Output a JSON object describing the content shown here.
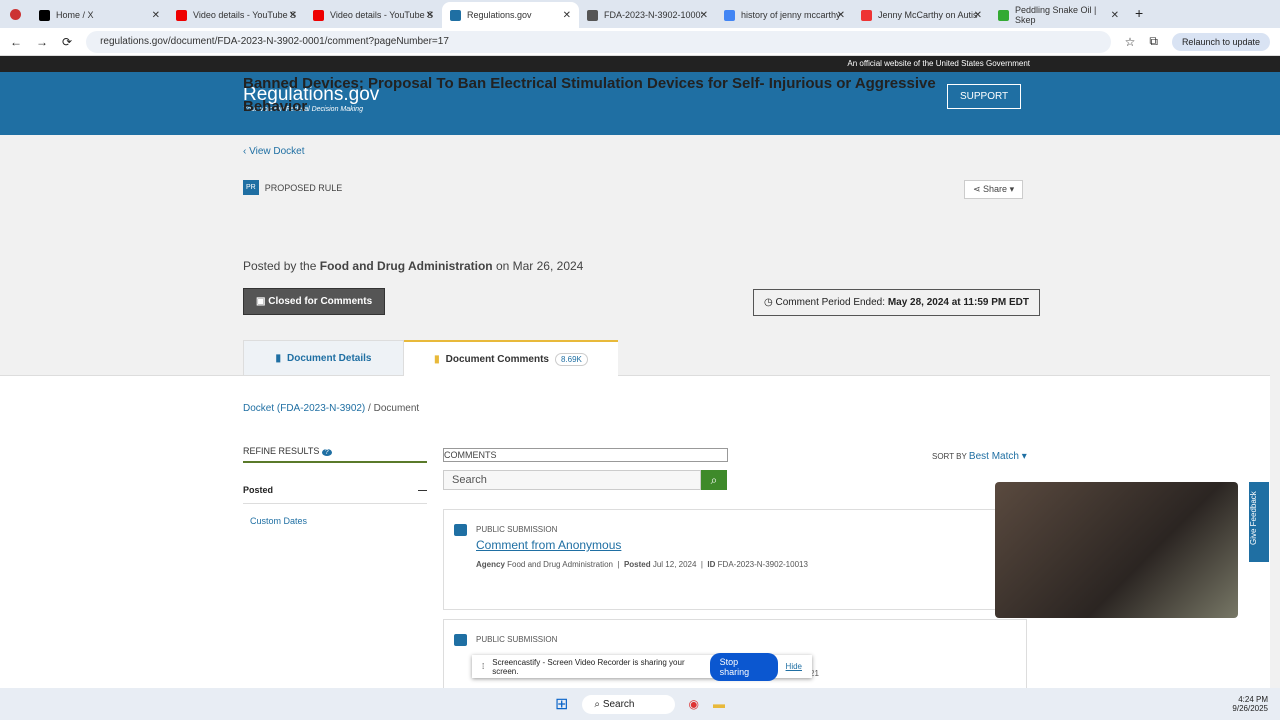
{
  "browser": {
    "tabs": [
      {
        "title": "Home / X",
        "color": "#000"
      },
      {
        "title": "Video details - YouTube S",
        "color": "#e00"
      },
      {
        "title": "Video details - YouTube S",
        "color": "#e00"
      },
      {
        "title": "Regulations.gov",
        "color": "#1f6fa3"
      },
      {
        "title": "FDA-2023-N-3902-1000:",
        "color": "#555"
      },
      {
        "title": "history of jenny mccarthy",
        "color": "#4285f4"
      },
      {
        "title": "Jenny McCarthy on Autis",
        "color": "#e33"
      },
      {
        "title": "Peddling Snake Oil | Skep",
        "color": "#3a3"
      }
    ],
    "url": "regulations.gov/document/FDA-2023-N-3902-0001/comment?pageNumber=17",
    "relaunch": "Relaunch to update"
  },
  "site": {
    "gov_banner": "An official website of the United States Government",
    "logo": "Regulations.gov",
    "tagline": "Your Voice in Federal Decision Making",
    "support": "SUPPORT"
  },
  "doc": {
    "back": "View Docket",
    "type_badge": "PR",
    "type": "PROPOSED RULE",
    "share": "Share",
    "title": "Banned Devices; Proposal To Ban Electrical Stimulation Devices for Self- Injurious or Aggressive Behavior",
    "posted_prefix": "Posted by the",
    "agency": "Food and Drug Administration",
    "posted_on": "on Mar 26, 2024",
    "closed": "Closed for Comments",
    "period_label": "Comment Period Ended:",
    "period_value": "May 28, 2024 at 11:59 PM EDT"
  },
  "tabs": {
    "details": "Document Details",
    "comments": "Document Comments",
    "count": "8.69K"
  },
  "breadcrumb": {
    "docket": "Docket (FDA-2023-N-3902)",
    "current": "Document"
  },
  "refine": {
    "title": "REFINE RESULTS",
    "posted": "Posted",
    "custom": "Custom Dates"
  },
  "search": {
    "label": "COMMENTS",
    "placeholder": "Search",
    "sort_label": "SORT BY",
    "sort_value": "Best Match"
  },
  "results": [
    {
      "kind": "PUBLIC SUBMISSION",
      "title": "Comment from Anonymous",
      "agency_label": "Agency",
      "agency": "Food and Drug Administration",
      "posted_label": "Posted",
      "posted": "Jul 12, 2024",
      "id_label": "ID",
      "id": "FDA-2023-N-3902-10013"
    },
    {
      "kind": "PUBLIC SUBMISSION",
      "tail": "21"
    }
  ],
  "share_bar": {
    "text": "Screencastify - Screen Video Recorder is sharing your screen.",
    "stop": "Stop sharing",
    "hide": "Hide"
  },
  "feedback": "Give Feedback",
  "taskbar": {
    "search": "Search",
    "time": "4:24 PM",
    "date": "9/26/2025"
  }
}
